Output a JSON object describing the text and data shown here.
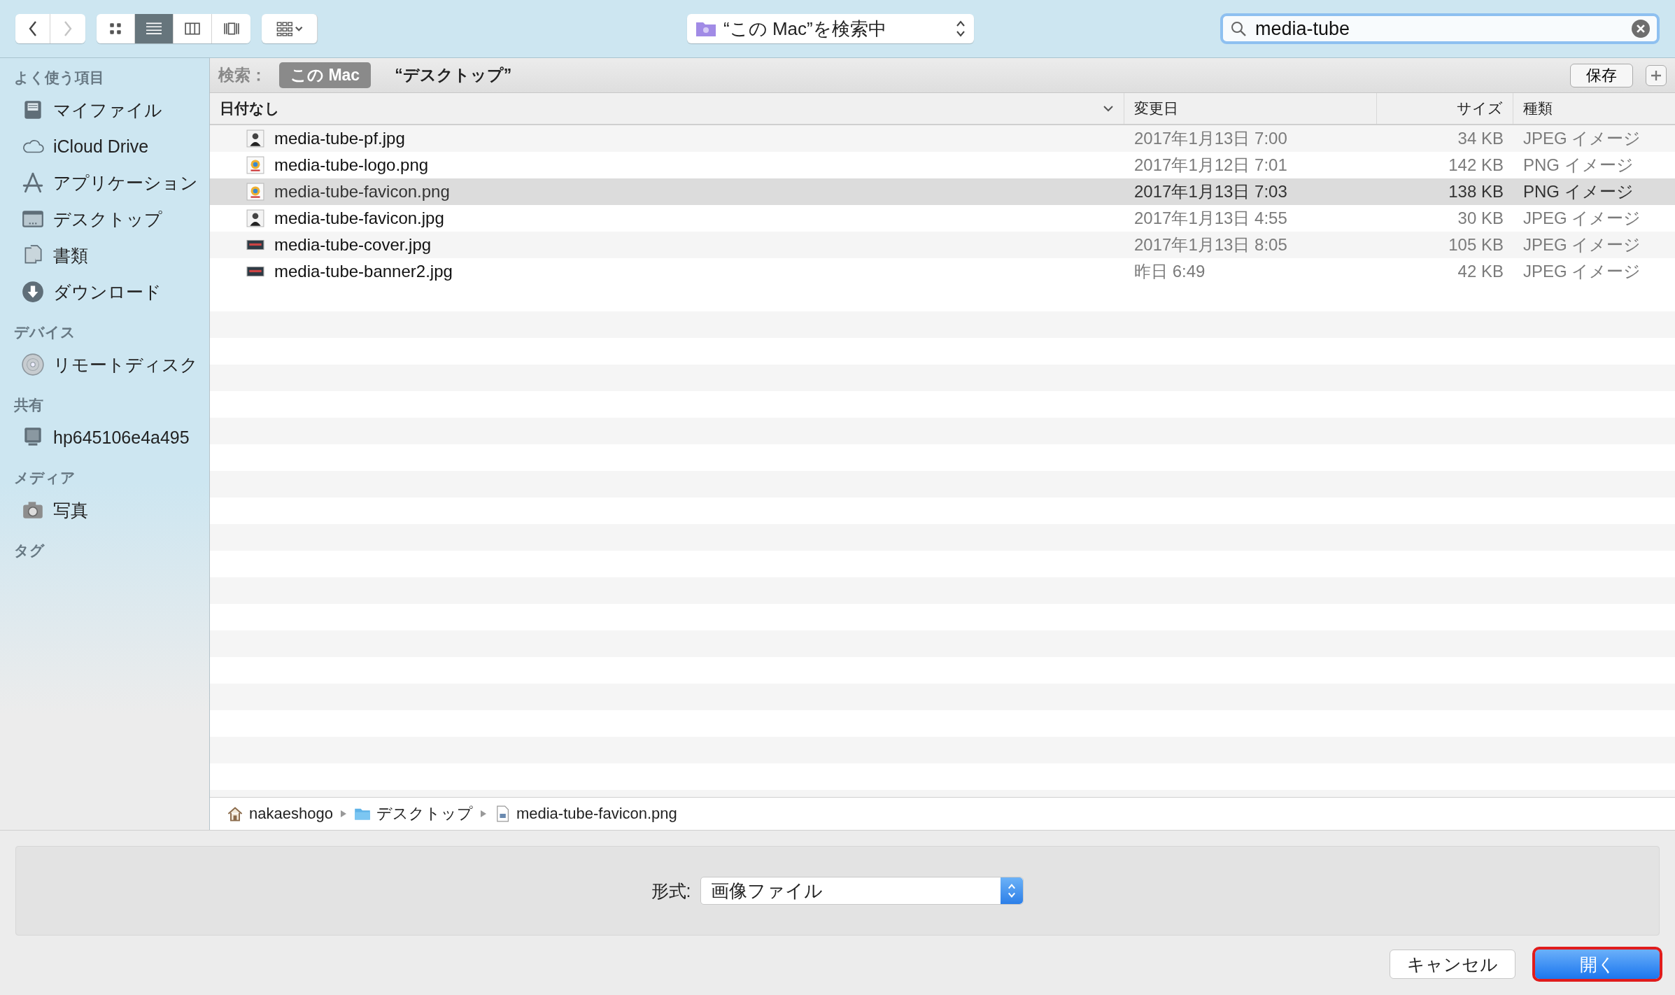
{
  "toolbar": {
    "back": {
      "disabled": false
    },
    "forward": {
      "disabled": true
    },
    "view_modes": [
      {
        "kind": "icon",
        "selected": false
      },
      {
        "kind": "list",
        "selected": true
      },
      {
        "kind": "columns",
        "selected": false
      },
      {
        "kind": "coverflow",
        "selected": false
      }
    ],
    "location": "“この Mac”を検索中",
    "search": {
      "value": "media-tube"
    }
  },
  "search_scope": {
    "label": "検索：",
    "scopes": [
      {
        "label": "この Mac",
        "selected": true
      },
      {
        "label": "“デスクトップ”",
        "selected": false
      }
    ],
    "save": "保存"
  },
  "sidebar": {
    "sections": [
      {
        "title": "よく使う項目",
        "items": [
          {
            "label": "マイファイル",
            "kind": "files"
          },
          {
            "label": "iCloud Drive",
            "kind": "cloud"
          },
          {
            "label": "アプリケーション",
            "kind": "apps"
          },
          {
            "label": "デスクトップ",
            "kind": "desktop"
          },
          {
            "label": "書類",
            "kind": "documents"
          },
          {
            "label": "ダウンロード",
            "kind": "download"
          }
        ]
      },
      {
        "title": "デバイス",
        "items": [
          {
            "label": "リモートディスク",
            "kind": "disc"
          }
        ]
      },
      {
        "title": "共有",
        "items": [
          {
            "label": "hp645106e4a495",
            "kind": "computer"
          }
        ]
      },
      {
        "title": "メディア",
        "items": [
          {
            "label": "写真",
            "kind": "camera"
          }
        ]
      },
      {
        "title": "タグ"
      }
    ]
  },
  "table": {
    "columns": [
      "日付なし",
      "変更日",
      "サイズ",
      "種類"
    ],
    "rows": [
      {
        "name": "media-tube-pf.jpg",
        "modified": "2017年1月13日 7:00",
        "size": "34 KB",
        "type_label": "JPEG イメージ",
        "kind": "portrait",
        "selected": false
      },
      {
        "name": "media-tube-logo.png",
        "modified": "2017年1月12日 7:01",
        "size": "142 KB",
        "type_label": "PNG イメージ",
        "kind": "logo",
        "selected": false
      },
      {
        "name": "media-tube-favicon.png",
        "modified": "2017年1月13日 7:03",
        "size": "138 KB",
        "type_label": "PNG イメージ",
        "kind": "logo",
        "selected": true
      },
      {
        "name": "media-tube-favicon.jpg",
        "modified": "2017年1月13日 4:55",
        "size": "30 KB",
        "type_label": "JPEG イメージ",
        "kind": "portrait",
        "selected": false
      },
      {
        "name": "media-tube-cover.jpg",
        "modified": "2017年1月13日 8:05",
        "size": "105 KB",
        "type_label": "JPEG イメージ",
        "kind": "banner",
        "selected": false
      },
      {
        "name": "media-tube-banner2.jpg",
        "modified": "昨日 6:49",
        "size": "42 KB",
        "type_label": "JPEG イメージ",
        "kind": "banner",
        "selected": false
      }
    ]
  },
  "path_bar": [
    {
      "label": "nakaeshogo",
      "kind": "home"
    },
    {
      "label": "デスクトップ",
      "kind": "folder"
    },
    {
      "label": "media-tube-favicon.png",
      "kind": "file"
    }
  ],
  "format": {
    "label": "形式:",
    "value": "画像ファイル"
  },
  "buttons": [
    {
      "label": "キャンセル",
      "kind": "cancel",
      "annotated": false
    },
    {
      "label": "開く",
      "kind": "default",
      "annotated": true
    }
  ]
}
